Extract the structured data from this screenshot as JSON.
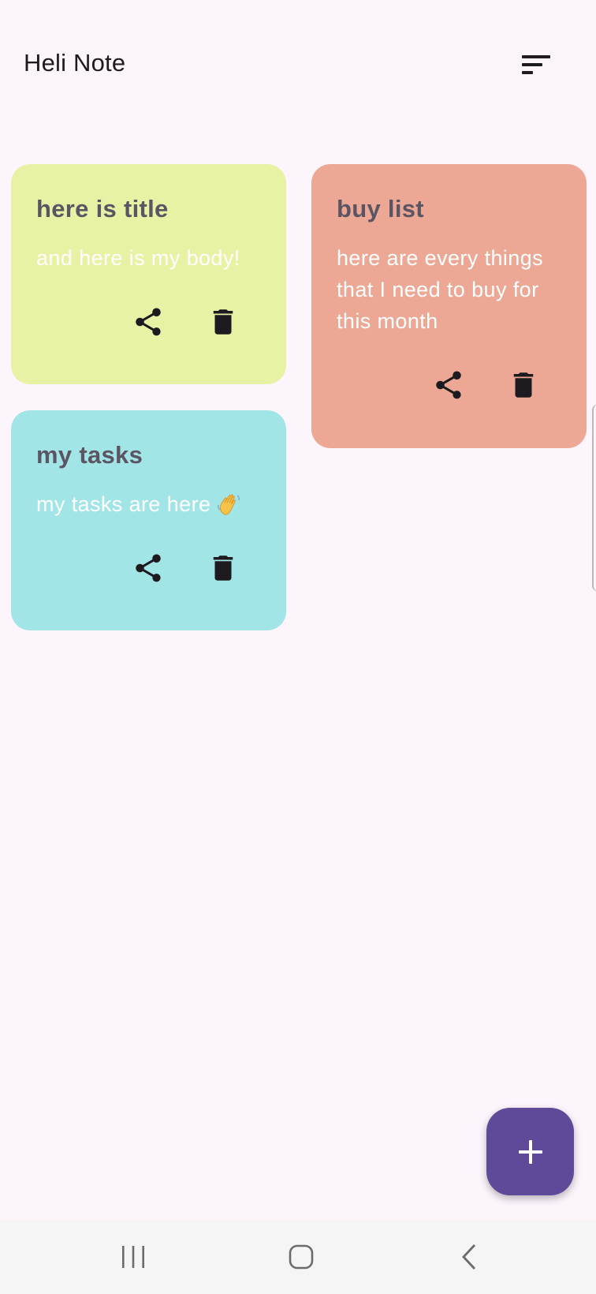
{
  "app": {
    "title": "Heli Note"
  },
  "toolbar": {
    "sort_icon": "sort-icon"
  },
  "notes": [
    {
      "title": "here is title",
      "body": "and here is my body!",
      "color": "#e8f2a5"
    },
    {
      "title": "buy list",
      "body": "here are every things that I need to buy for this month",
      "color": "#eca895"
    },
    {
      "title": "my tasks",
      "body": "my tasks are here",
      "body_emoji": "waving-hand-emoji",
      "color": "#a2e5e6"
    }
  ],
  "card_actions": {
    "share_icon": "share-icon",
    "delete_icon": "delete-icon"
  },
  "fab": {
    "icon": "plus-icon",
    "color": "#5f4a9a"
  },
  "system_nav": {
    "recents_icon": "recents-icon",
    "home_icon": "home-icon",
    "back_icon": "back-icon"
  },
  "colors": {
    "background": "#fcf5fc",
    "title_text": "#5b5563",
    "body_text": "#ffffff",
    "icon": "#1d1b20"
  }
}
